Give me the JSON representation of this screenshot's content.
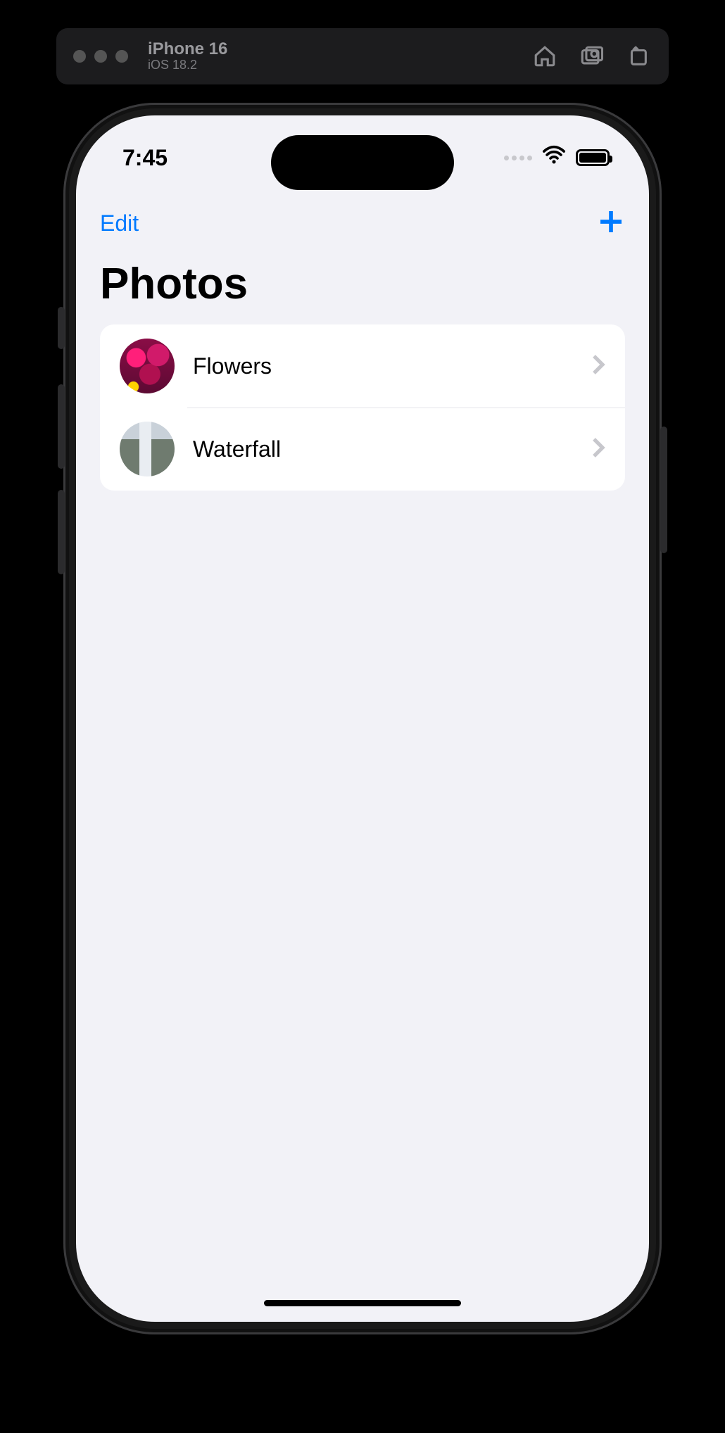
{
  "simulator": {
    "device": "iPhone 16",
    "os": "iOS 18.2",
    "icons": {
      "home": "home-icon",
      "screenshot": "screenshot-icon",
      "rotate": "rotate-icon"
    }
  },
  "status_bar": {
    "time": "7:45"
  },
  "nav": {
    "edit_label": "Edit",
    "add_label": "+"
  },
  "page_title": "Photos",
  "list": {
    "items": [
      {
        "label": "Flowers",
        "thumb": "flowers"
      },
      {
        "label": "Waterfall",
        "thumb": "waterfall"
      }
    ]
  },
  "colors": {
    "accent": "#007aff",
    "background": "#f2f2f7",
    "card": "#ffffff",
    "separator": "#e5e5ea",
    "chevron": "#c7c7cc"
  }
}
